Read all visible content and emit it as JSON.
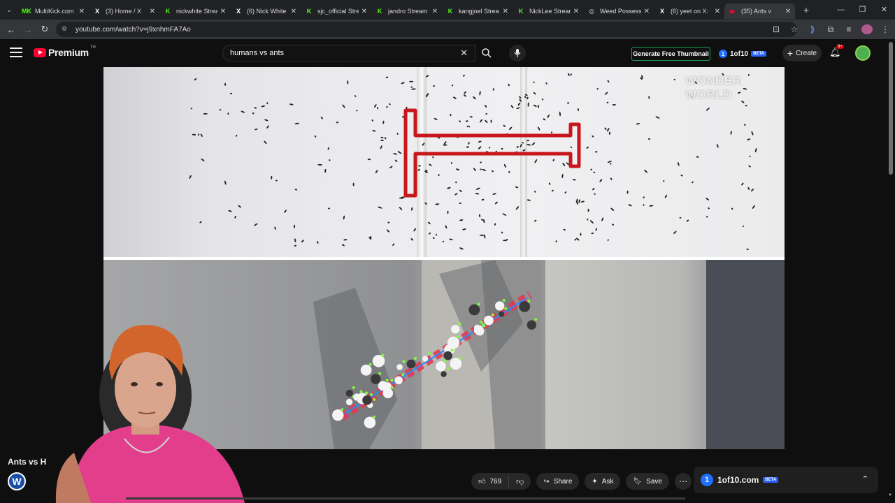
{
  "browser": {
    "tabs": [
      {
        "label": "MultiKick.com",
        "favicon": "MK",
        "color": "#53fc18"
      },
      {
        "label": "(3) Home / X",
        "favicon": "X",
        "color": "#ffffff"
      },
      {
        "label": "nickwhite Strea",
        "favicon": "K",
        "color": "#53fc18"
      },
      {
        "label": "(6) Nick White",
        "favicon": "X",
        "color": "#ffffff"
      },
      {
        "label": "sjc_official Stre",
        "favicon": "K",
        "color": "#53fc18"
      },
      {
        "label": "jandro Stream",
        "favicon": "K",
        "color": "#53fc18"
      },
      {
        "label": "kangjoel Strea",
        "favicon": "K",
        "color": "#53fc18"
      },
      {
        "label": "NickLee Stream",
        "favicon": "K",
        "color": "#53fc18"
      },
      {
        "label": "Weed Possessi",
        "favicon": "◎",
        "color": "#dddddd"
      },
      {
        "label": "(6) yeet on X:",
        "favicon": "X",
        "color": "#ffffff"
      },
      {
        "label": "(35) Ants v",
        "favicon": "▶",
        "color": "#ff0033",
        "active": true
      }
    ],
    "url": "youtube.com/watch?v=j9xnhmFA7Ao"
  },
  "header": {
    "logo_text": "Premium",
    "logo_sup": "TH",
    "search_value": "humans vs ants",
    "thumbnail_button": "Generate Free Thumbnail",
    "of10_num": "1",
    "of10_label": "1of10",
    "beta": "BETA",
    "create_label": "Create",
    "notif_badge": "9+"
  },
  "video": {
    "watermark": "WONDER WORLD"
  },
  "below": {
    "title": "Ants vs H",
    "channel_initial": "W",
    "like_count": "769",
    "share_label": "Share",
    "ask_label": "Ask",
    "save_label": "Save"
  },
  "side_panel": {
    "num": "1",
    "label": "1of10.com",
    "beta": "BETA"
  },
  "colors": {
    "accent_red": "#ff0033",
    "kick_green": "#53fc18",
    "beta_blue": "#2962ff"
  }
}
